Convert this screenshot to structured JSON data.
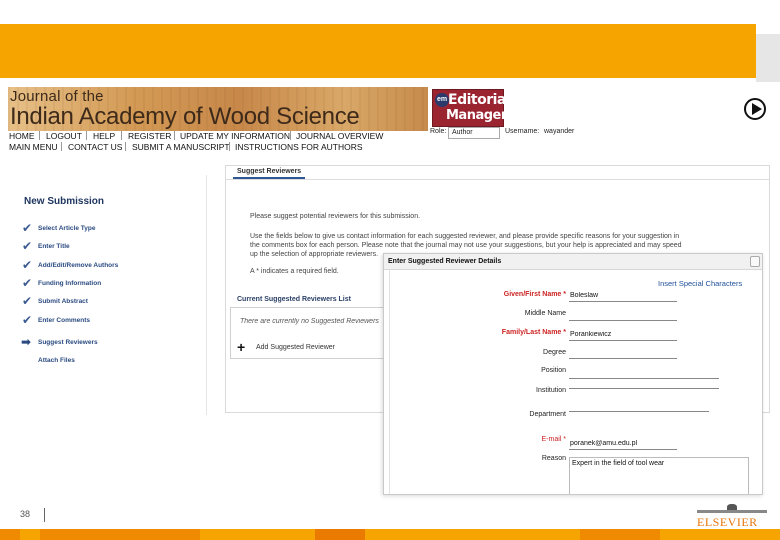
{
  "journal": {
    "title_line1": "Journal of the",
    "title_line2": "Indian Academy of Wood Science"
  },
  "editorial_manager": {
    "badge": "em",
    "line1": "Editorial",
    "line2": "Manager"
  },
  "nav": {
    "row1": [
      "HOME",
      "LOGOUT",
      "HELP",
      "REGISTER",
      "UPDATE MY INFORMATION",
      "JOURNAL OVERVIEW"
    ],
    "row2": [
      "MAIN MENU",
      "CONTACT US",
      "SUBMIT A MANUSCRIPT",
      "INSTRUCTIONS FOR AUTHORS"
    ]
  },
  "role": {
    "label": "Role:",
    "value": "Author"
  },
  "user": {
    "label": "Username:",
    "value": "wayander"
  },
  "submission": {
    "heading": "New Submission",
    "steps": [
      {
        "label": "Select Article Type",
        "status": "done"
      },
      {
        "label": "Enter Title",
        "status": "done"
      },
      {
        "label": "Add/Edit/Remove Authors",
        "status": "done"
      },
      {
        "label": "Funding Information",
        "status": "done"
      },
      {
        "label": "Submit Abstract",
        "status": "done"
      },
      {
        "label": "Enter Comments",
        "status": "done"
      },
      {
        "label": "Suggest Reviewers",
        "status": "current"
      },
      {
        "label": "Attach Files",
        "status": "pending"
      }
    ]
  },
  "tab": {
    "label": "Suggest Reviewers"
  },
  "info": {
    "p1": "Please suggest potential reviewers for this submission.",
    "p2_line1": "Use the fields below to give us contact information for each suggested reviewer, and please provide specific reasons for your suggestion in",
    "p2_line2": "the comments box for each person. Please note that the journal may not use your suggestions, but your help is appreciated and may speed",
    "p2_line3": "up the selection of appropriate reviewers.",
    "p3": "A * indicates a required field."
  },
  "current_list": {
    "title": "Current Suggested Reviewers List",
    "empty": "There are currently no Suggested Reviewers",
    "add_label": "Add Suggested Reviewer"
  },
  "dialog": {
    "title": "Enter Suggested Reviewer Details",
    "special_chars": "Insert Special Characters",
    "fields": {
      "first_name": {
        "label": "Given/First Name *",
        "value": "Boleslaw"
      },
      "middle_name": {
        "label": "Middle Name",
        "value": ""
      },
      "last_name": {
        "label": "Family/Last Name *",
        "value": "Porankiewicz"
      },
      "degree": {
        "label": "Degree",
        "value": ""
      },
      "position": {
        "label": "Position",
        "value": ""
      },
      "institution": {
        "label": "Institution",
        "value": ""
      },
      "department": {
        "label": "Department",
        "value": ""
      },
      "email": {
        "label": "E-mail *",
        "value": "poranek@amu.edu.pl"
      },
      "reason": {
        "label": "Reason",
        "value": "Expert in the field of tool wear"
      }
    }
  },
  "footer": {
    "page_number": "38",
    "publisher": "ELSEVIER"
  },
  "colors": {
    "top_bar": "#f5a400",
    "nav_blue": "#2a4a80",
    "required_red": "#c22222",
    "em_logo": "#9a2531"
  },
  "bottom_strip_colors": [
    "#f08a00",
    "#f5a400",
    "#f08a00",
    "#f5a400",
    "#ea7a00",
    "#f5a400",
    "#f08a00",
    "#f5a400"
  ]
}
